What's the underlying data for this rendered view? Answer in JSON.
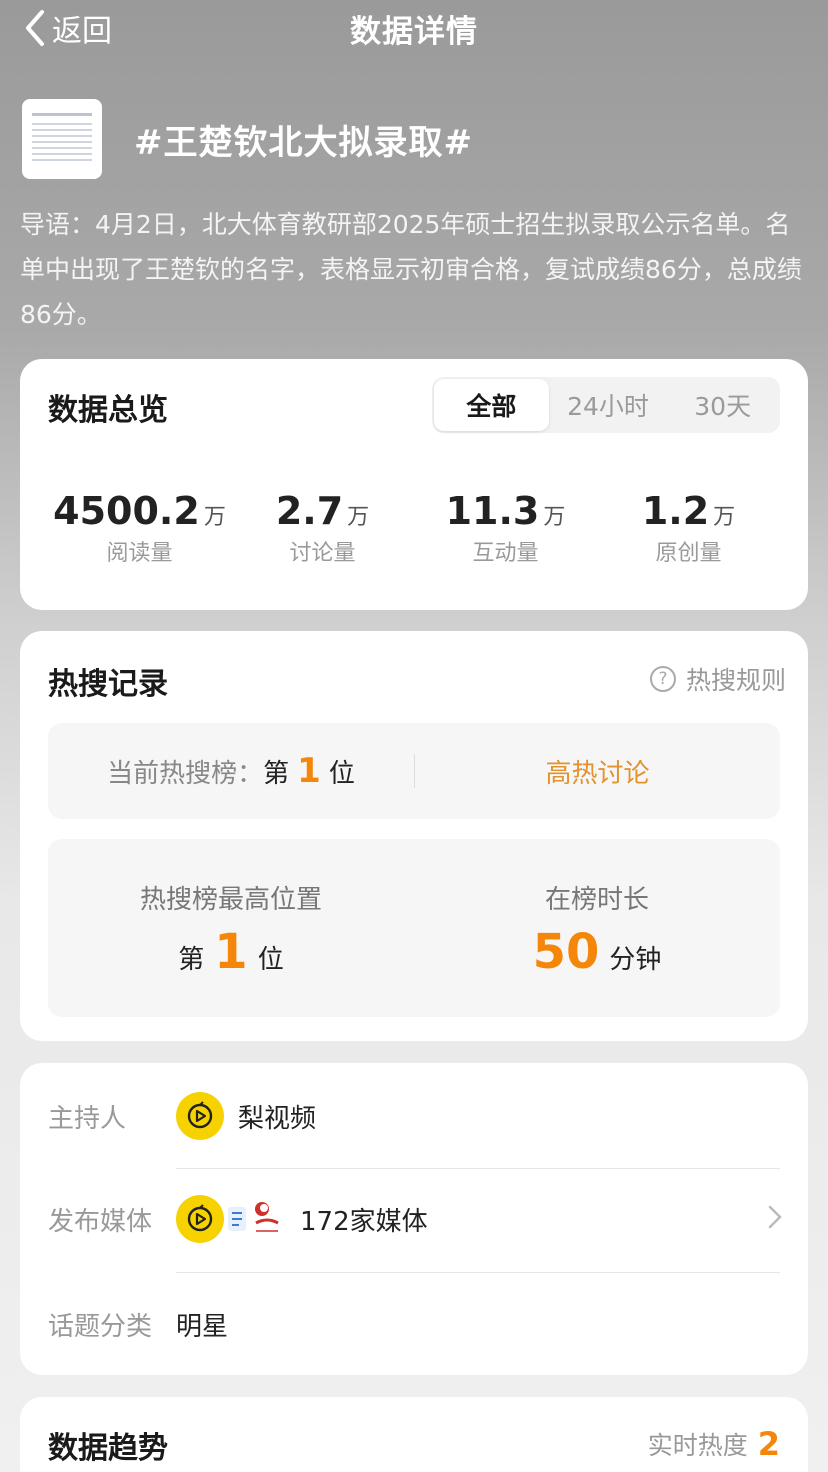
{
  "nav": {
    "back_label": "返回",
    "title": "数据详情"
  },
  "topic": {
    "title": "#王楚钦北大拟录取#",
    "intro": "导语：4月2日，北大体育教研部2025年硕士招生拟录取公示名单。名单中出现了王楚钦的名字，表格显示初审合格，复试成绩86分，总成绩86分。"
  },
  "overview": {
    "title": "数据总览",
    "tabs": [
      {
        "label": "全部",
        "active": true
      },
      {
        "label": "24小时",
        "active": false
      },
      {
        "label": "30天",
        "active": false
      }
    ],
    "stats": [
      {
        "value": "4500.2",
        "unit": "万",
        "label": "阅读量"
      },
      {
        "value": "2.7",
        "unit": "万",
        "label": "讨论量"
      },
      {
        "value": "11.3",
        "unit": "万",
        "label": "互动量"
      },
      {
        "value": "1.2",
        "unit": "万",
        "label": "原创量"
      }
    ]
  },
  "hot": {
    "title": "热搜记录",
    "rules_label": "热搜规则",
    "rules_icon": "?",
    "current_label": "当前热搜榜：",
    "rank_prefix": "第",
    "current_rank": "1",
    "rank_suffix": "位",
    "status": "高热讨论",
    "best_label": "热搜榜最高位置",
    "best_rank": "1",
    "duration_label": "在榜时长",
    "duration_value": "50",
    "duration_unit": "分钟",
    "accent_color": "#f4870a"
  },
  "info": {
    "host_key": "主持人",
    "host_name": "梨视频",
    "media_key": "发布媒体",
    "media_count": "172家媒体",
    "category_key": "话题分类",
    "category_value": "明星"
  },
  "trend": {
    "title": "数据趋势",
    "realtime_label": "实时热度",
    "realtime_value": "2"
  }
}
